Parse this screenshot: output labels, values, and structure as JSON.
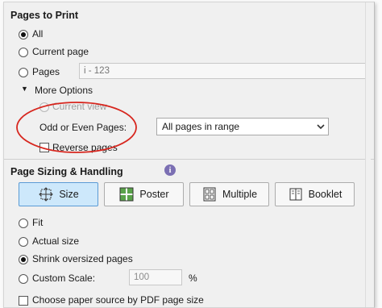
{
  "pages_to_print": {
    "title": "Pages to Print",
    "options": {
      "all": "All",
      "current_page": "Current page",
      "pages": "Pages"
    },
    "pages_placeholder": "i - 123",
    "more_options": "More Options",
    "current_view": "Current view",
    "odd_even_label": "Odd or Even Pages:",
    "odd_even_selected": "All pages in range",
    "reverse_pages": "Reverse pages"
  },
  "page_sizing": {
    "title": "Page Sizing & Handling",
    "buttons": {
      "size": "Size",
      "poster": "Poster",
      "multiple": "Multiple",
      "booklet": "Booklet"
    },
    "options": {
      "fit": "Fit",
      "actual_size": "Actual size",
      "shrink": "Shrink oversized pages",
      "custom_scale": "Custom Scale:"
    },
    "scale_value": "100",
    "percent": "%",
    "paper_source": "Choose paper source by PDF page size"
  },
  "colors": {
    "annotation_red": "#d7261e",
    "active_button_bg": "#cde8fb",
    "info_icon": "#7b6fb3"
  }
}
